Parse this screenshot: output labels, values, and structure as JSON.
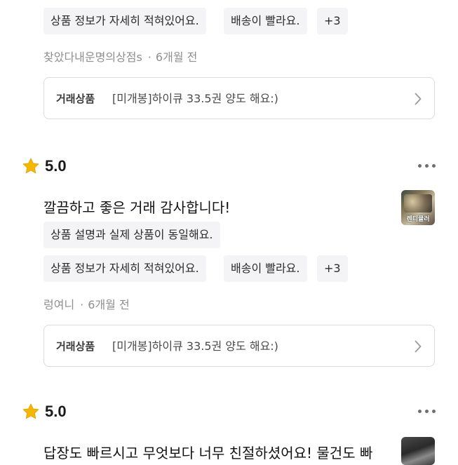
{
  "review0": {
    "tags_row2": [
      "상품 정보가 자세히 적혀있어요.",
      "배송이 빨라요.",
      "+3"
    ],
    "author": "찾았다내운명의상점s",
    "time": "6개월 전",
    "trade_label": "거래상품",
    "trade_name": "[미개봉]하이큐 33.5권 양도 해요:)"
  },
  "review1": {
    "rating": "5.0",
    "title": "깔끔하고 좋은 거래 감사합니다!",
    "tags_row1": [
      "상품 설명과 실제 상품이 동일해요."
    ],
    "tags_row2": [
      "상품 정보가 자세히 적혀있어요.",
      "배송이 빨라요.",
      "+3"
    ],
    "author": "렁여니",
    "time": "6개월 전",
    "trade_label": "거래상품",
    "trade_name": "[미개봉]하이큐 33.5권 양도 해요:)",
    "thumb_text": "렌티큘러"
  },
  "review2": {
    "rating": "5.0",
    "title": "답장도 빠르시고 무엇보다 너무 친절하셨어요! 물건도 빠"
  },
  "colors": {
    "star": "#f5b800",
    "chip_bg": "#f4f4f6",
    "meta": "#8e8e93",
    "border": "#dcdcdf"
  },
  "icons": [
    "star-icon",
    "more-icon",
    "chevron-right-icon"
  ]
}
